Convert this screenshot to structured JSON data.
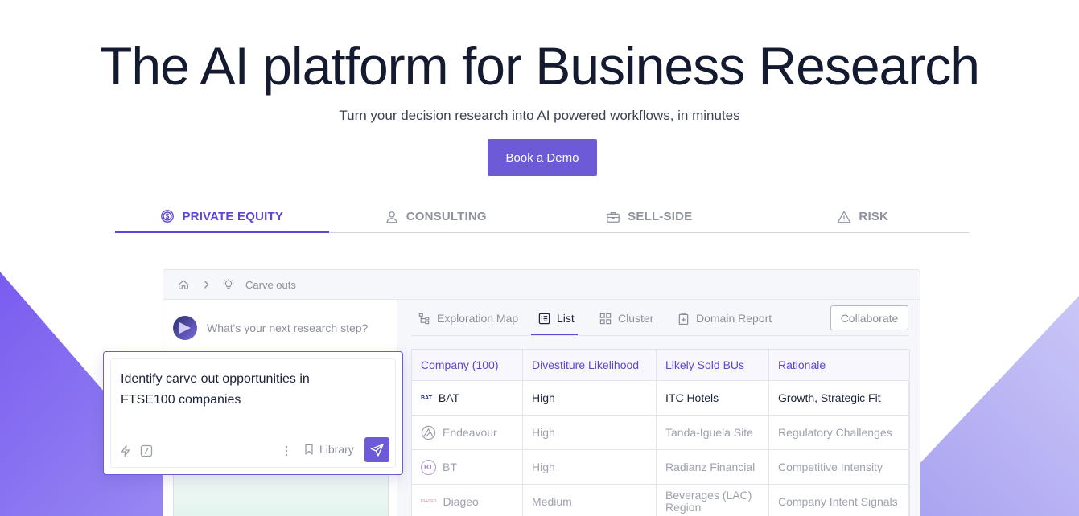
{
  "hero": {
    "title": "The AI platform for Business Research",
    "subtitle": "Turn your decision research into AI powered workflows, in minutes",
    "cta_label": "Book a Demo"
  },
  "tabs": [
    {
      "label": "PRIVATE EQUITY",
      "icon": "dollar-circle-icon",
      "active": true
    },
    {
      "label": "CONSULTING",
      "icon": "user-icon",
      "active": false
    },
    {
      "label": "SELL-SIDE",
      "icon": "briefcase-icon",
      "active": false
    },
    {
      "label": "RISK",
      "icon": "warning-triangle-icon",
      "active": false
    }
  ],
  "app": {
    "breadcrumb": {
      "current": "Carve outs"
    },
    "ask_placeholder": "What's your next research step?",
    "view_tabs": [
      {
        "label": "Exploration Map",
        "icon": "tree-icon"
      },
      {
        "label": "List",
        "icon": "list-icon",
        "active": true
      },
      {
        "label": "Cluster",
        "icon": "grid-icon"
      },
      {
        "label": "Domain Report",
        "icon": "report-icon"
      }
    ],
    "collaborate_label": "Collaborate",
    "table": {
      "headers": [
        "Company (100)",
        "Divestiture Likelihood",
        "Likely Sold BUs",
        "Rationale"
      ],
      "rows": [
        {
          "company": "BAT",
          "logo": "BAT",
          "likelihood": "High",
          "bus": "ITC Hotels",
          "rationale": "Growth, Strategic Fit"
        },
        {
          "company": "Endeavour",
          "logo": "endeavour-logo",
          "likelihood": "High",
          "bus": "Tanda-Iguela Site",
          "rationale": "Regulatory Challenges"
        },
        {
          "company": "BT",
          "logo": "BT",
          "likelihood": "High",
          "bus": "Radianz Financial",
          "rationale": "Competitive Intensity"
        },
        {
          "company": "Diageo",
          "logo": "DIAGEO",
          "likelihood": "Medium",
          "bus": "Beverages (LAC) Region",
          "rationale": "Company Intent Signals"
        }
      ]
    },
    "composer": {
      "prompt": "Identify carve out opportunities in FTSE100 companies",
      "library_label": "Library"
    }
  },
  "colors": {
    "accent": "#6c5ad6",
    "accent_text": "#5b47d0",
    "title": "#141a30"
  }
}
